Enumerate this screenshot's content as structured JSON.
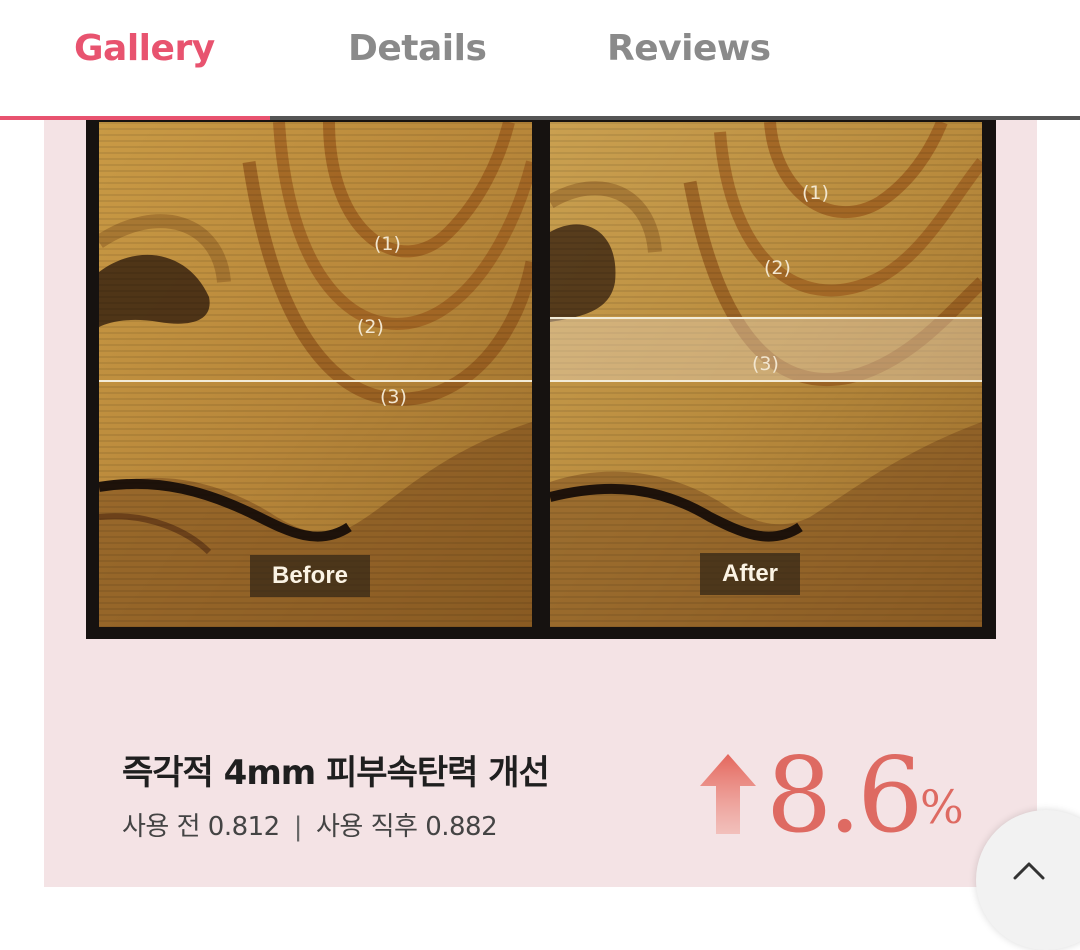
{
  "tabs": [
    {
      "label": "Gallery",
      "active": true
    },
    {
      "label": "Details",
      "active": false
    },
    {
      "label": "Reviews",
      "active": false
    }
  ],
  "colors": {
    "active_tab": "#e8536f",
    "inactive_tab": "#8a8a8a",
    "panel_bg": "#f4e3e5",
    "stat_color": "#de6a62"
  },
  "comparison": {
    "before": {
      "label": "Before",
      "markers": [
        "(1)",
        "(2)",
        "(3)"
      ]
    },
    "after": {
      "label": "After",
      "markers": [
        "(1)",
        "(2)",
        "(3)"
      ]
    }
  },
  "result": {
    "headline": "즉각적 4mm 피부속탄력 개선",
    "before_measure": "사용 전 0.812",
    "separator": "|",
    "after_measure": "사용 직후 0.882",
    "stat_value": "8.6",
    "stat_unit": "%",
    "stat_direction_icon": "arrow-up-icon"
  },
  "scroll_top_icon": "chevron-up-icon"
}
